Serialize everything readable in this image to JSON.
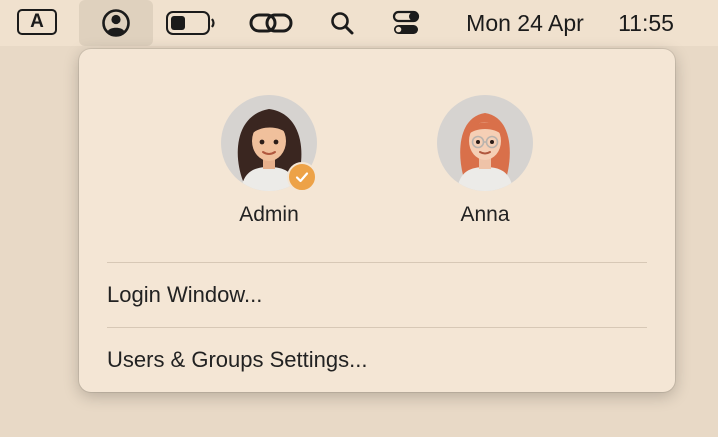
{
  "menubar": {
    "input_source_label": "A",
    "date": "Mon 24 Apr",
    "time": "11:55",
    "icons": [
      "user-circle-icon",
      "battery-icon",
      "link-icon",
      "search-icon",
      "control-center-icon"
    ]
  },
  "users": [
    {
      "name": "Admin",
      "current": true
    },
    {
      "name": "Anna",
      "current": false
    }
  ],
  "menu": {
    "login_window": "Login Window...",
    "users_groups": "Users & Groups Settings..."
  },
  "colors": {
    "background": "#e8d9c6",
    "menubar": "#f0e1ce",
    "panel": "#f4e6d5",
    "badge": "#eda247"
  }
}
